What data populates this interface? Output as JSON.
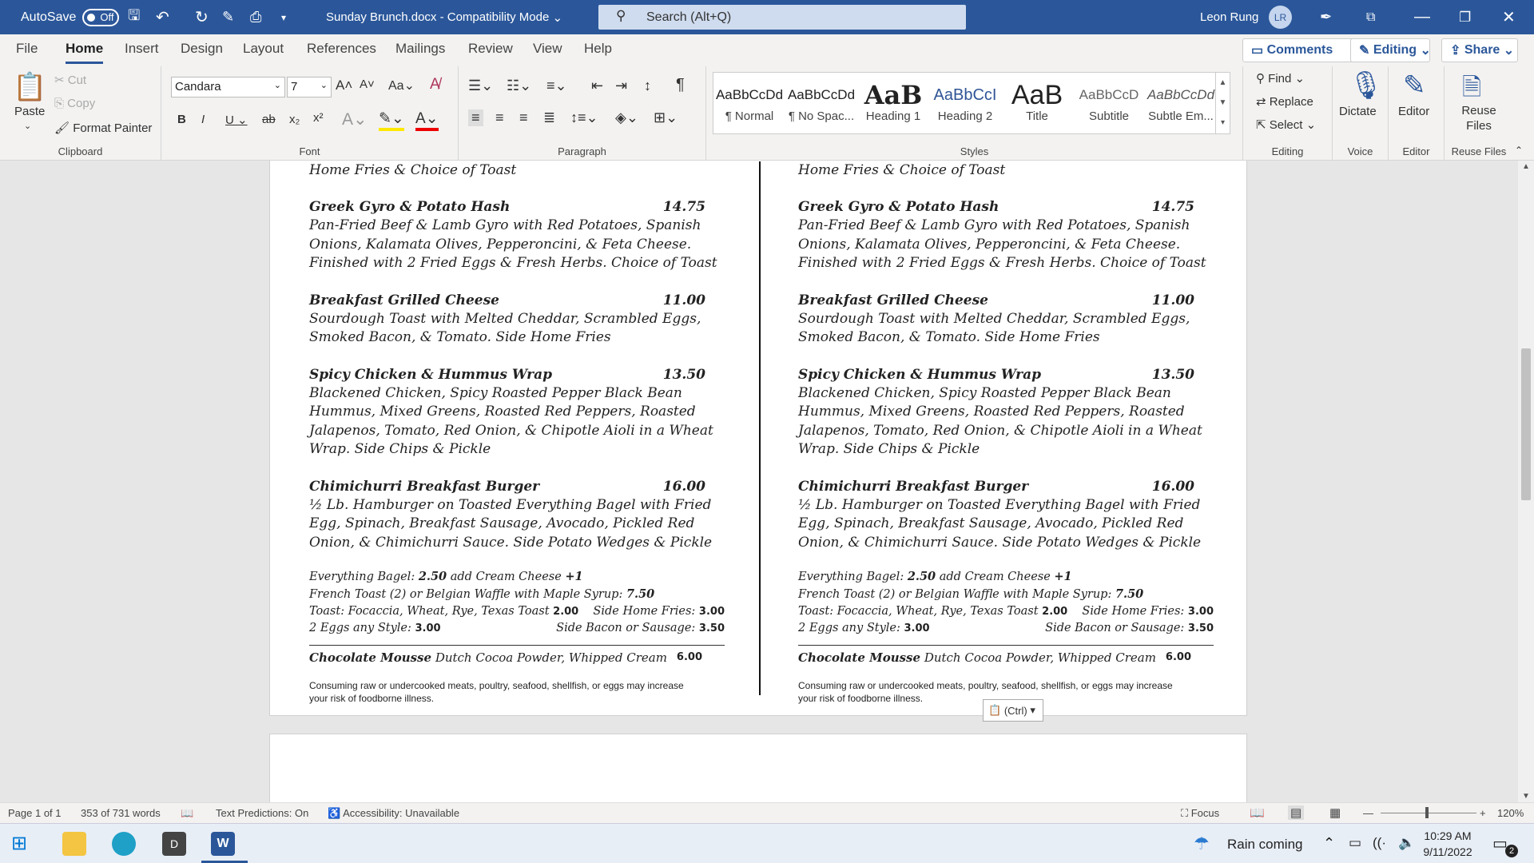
{
  "titlebar": {
    "autosave": "AutoSave",
    "toggle": "Off",
    "doc_title": "Sunday Brunch.docx  -  Compatibility Mode",
    "search_placeholder": "Search (Alt+Q)",
    "user": "Leon Rung",
    "initials": "LR"
  },
  "tabs": [
    "File",
    "Home",
    "Insert",
    "Design",
    "Layout",
    "References",
    "Mailings",
    "Review",
    "View",
    "Help"
  ],
  "right_buttons": {
    "comments": "Comments",
    "editing": "Editing",
    "share": "Share"
  },
  "ribbon": {
    "clipboard": {
      "paste": "Paste",
      "cut": "Cut",
      "copy": "Copy",
      "format_painter": "Format Painter",
      "label": "Clipboard"
    },
    "font": {
      "name": "Candara",
      "size": "7",
      "label": "Font"
    },
    "paragraph": {
      "label": "Paragraph"
    },
    "styles": {
      "items": [
        {
          "preview": "AaBbCcDd",
          "name": "¶ Normal"
        },
        {
          "preview": "AaBbCcDd",
          "name": "¶ No Spac..."
        },
        {
          "preview": "AaB",
          "name": "Heading 1"
        },
        {
          "preview": "AaBbCcI",
          "name": "Heading 2"
        },
        {
          "preview": "AaB",
          "name": "Title"
        },
        {
          "preview": "AaBbCcD",
          "name": "Subtitle"
        },
        {
          "preview": "AaBbCcDd",
          "name": "Subtle Em..."
        }
      ],
      "label": "Styles"
    },
    "editing": {
      "find": "Find",
      "replace": "Replace",
      "select": "Select",
      "label": "Editing"
    },
    "voice": {
      "dictate": "Dictate",
      "label": "Voice"
    },
    "editor": {
      "editor": "Editor",
      "label": "Editor"
    },
    "reuse": {
      "reuse": "Reuse Files",
      "label": "Reuse Files"
    }
  },
  "menu": {
    "top_line": "Home Fries & Choice of Toast",
    "items": [
      {
        "name": "Greek Gyro & Potato Hash",
        "price": "14.75",
        "desc": "Pan-Fried Beef & Lamb Gyro with Red Potatoes, Spanish Onions, Kalamata Olives, Pepperoncini, & Feta Cheese. Finished with 2 Fried Eggs & Fresh Herbs. Choice of Toast"
      },
      {
        "name": "Breakfast Grilled Cheese",
        "price": "11.00",
        "desc": "Sourdough Toast with Melted Cheddar, Scrambled Eggs, Smoked Bacon, & Tomato. Side Home Fries"
      },
      {
        "name": "Spicy Chicken & Hummus Wrap",
        "price": "13.50",
        "desc": "Blackened Chicken, Spicy Roasted Pepper Black Bean Hummus, Mixed Greens, Roasted Red Peppers, Roasted Jalapenos, Tomato, Red Onion, & Chipotle Aioli in a Wheat Wrap. Side Chips & Pickle"
      },
      {
        "name": "Chimichurri Breakfast Burger",
        "price": "16.00",
        "desc": "½ Lb. Hamburger on Toasted Everything Bagel with Fried Egg, Spinach, Breakfast Sausage, Avocado, Pickled Red Onion, & Chimichurri Sauce. Side Potato Wedges & Pickle"
      }
    ],
    "extras": {
      "l1a": "Everything Bagel: ",
      "l1b": "2.50",
      "l1c": " add Cream Cheese ",
      "l1d": "+1",
      "l2a": "French Toast (2) or Belgian Waffle with Maple Syrup: ",
      "l2b": "7.50",
      "l3a": "Toast: Focaccia, Wheat, Rye, Texas Toast ",
      "l3b": "2.00",
      "l3c": "Side Home Fries: ",
      "l3d": "3.00",
      "l4a": "2 Eggs any Style: ",
      "l4b": "3.00",
      "l4c": "Side Bacon or Sausage: ",
      "l4d": "3.50"
    },
    "dessert": {
      "name": "Chocolate Mousse",
      "desc": " Dutch Cocoa Powder, Whipped Cream",
      "price": "6.00"
    },
    "note": "Consuming raw or undercooked meats, poultry, seafood, shellfish, or eggs may increase your risk of foodborne illness."
  },
  "paste_options": "(Ctrl)",
  "status": {
    "page": "Page 1 of 1",
    "words": "353 of 731 words",
    "predictions": "Text Predictions: On",
    "accessibility": "Accessibility: Unavailable",
    "focus": "Focus",
    "zoom": "120%"
  },
  "taskbar": {
    "weather": "Rain coming",
    "time": "10:29 AM",
    "date": "9/11/2022",
    "notif": "2"
  }
}
